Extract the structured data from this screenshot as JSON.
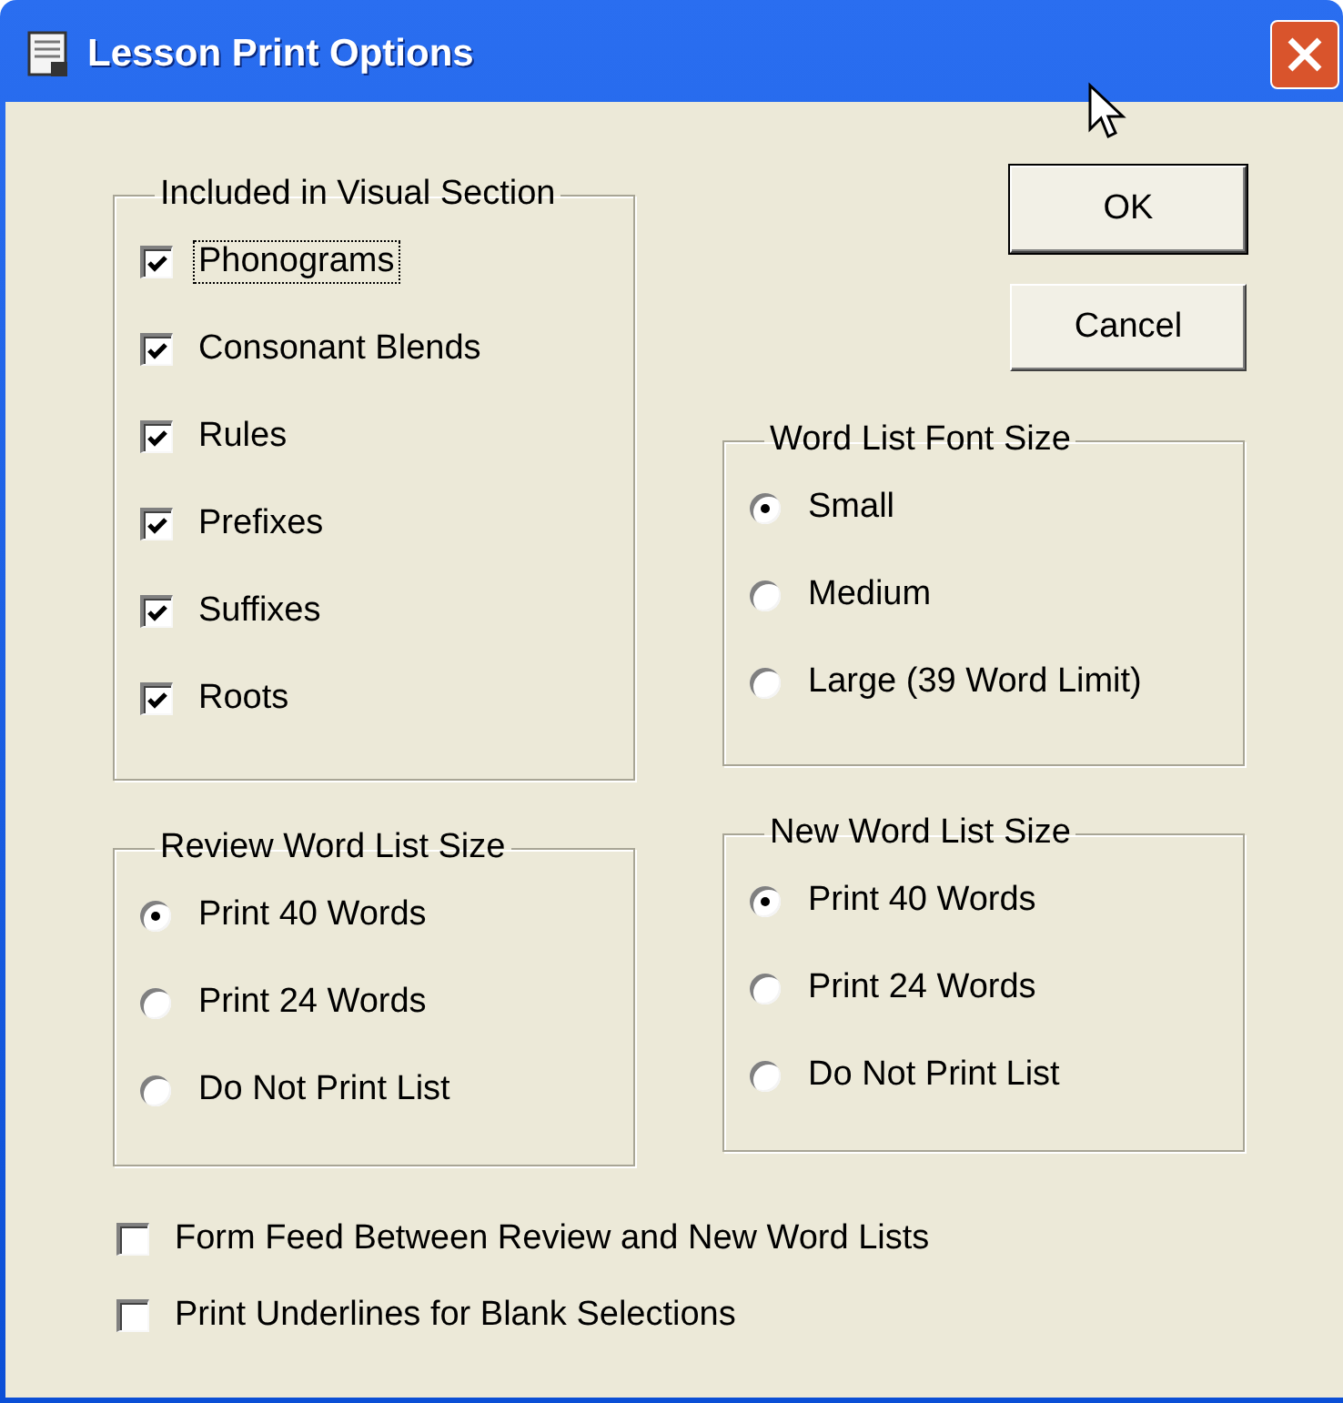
{
  "window": {
    "title": "Lesson Print Options"
  },
  "visual_section": {
    "title": "Included in Visual Section",
    "items": [
      {
        "label": "Phonograms",
        "checked": true,
        "focused": true
      },
      {
        "label": "Consonant Blends",
        "checked": true,
        "focused": false
      },
      {
        "label": "Rules",
        "checked": true,
        "focused": false
      },
      {
        "label": "Prefixes",
        "checked": true,
        "focused": false
      },
      {
        "label": "Suffixes",
        "checked": true,
        "focused": false
      },
      {
        "label": "Roots",
        "checked": true,
        "focused": false
      }
    ]
  },
  "buttons": [
    {
      "label": "OK",
      "default": true
    },
    {
      "label": "Cancel",
      "default": false
    }
  ],
  "font_size": {
    "title": "Word List Font Size",
    "options": [
      {
        "label": "Small",
        "selected": true
      },
      {
        "label": "Medium",
        "selected": false
      },
      {
        "label": "Large (39 Word Limit)",
        "selected": false
      }
    ]
  },
  "review_size": {
    "title": "Review Word List Size",
    "options": [
      {
        "label": "Print 40 Words",
        "selected": true
      },
      {
        "label": "Print 24 Words",
        "selected": false
      },
      {
        "label": "Do Not Print List",
        "selected": false
      }
    ]
  },
  "new_size": {
    "title": "New Word List Size",
    "options": [
      {
        "label": "Print 40 Words",
        "selected": true
      },
      {
        "label": "Print 24 Words",
        "selected": false
      },
      {
        "label": "Do Not Print List",
        "selected": false
      }
    ]
  },
  "options": [
    {
      "label": "Form Feed Between Review and New Word Lists",
      "checked": false
    },
    {
      "label": "Print Underlines for Blank Selections",
      "checked": false
    }
  ]
}
